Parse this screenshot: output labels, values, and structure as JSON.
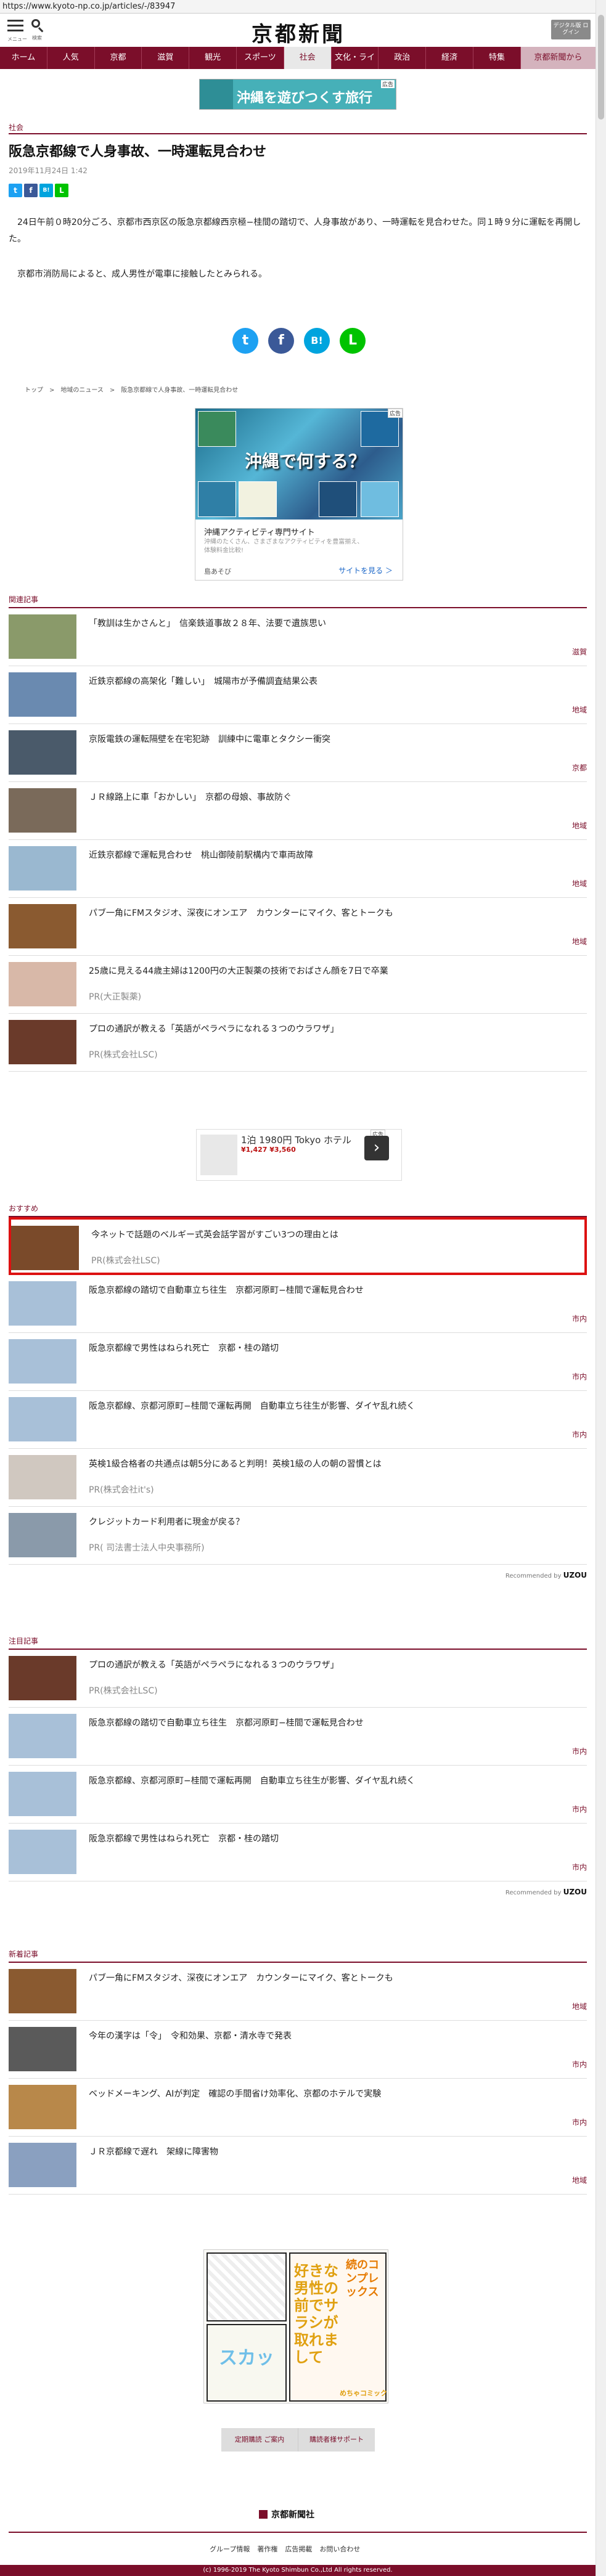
{
  "browser": {
    "url": "https://www.kyoto-np.co.jp/articles/-/83947"
  },
  "header": {
    "menu_label": "メニュー",
    "search_label": "検索",
    "logo": "京都新聞",
    "digital_button": "デジタル版 ログイン"
  },
  "nav": [
    "ホーム",
    "人気",
    "京都",
    "滋賀",
    "観光",
    "スポーツ",
    "社会",
    "文化・ライフ",
    "政治",
    "経済",
    "特集",
    "京都新聞から"
  ],
  "nav_active": "社会",
  "top_ad": {
    "text": "沖縄を遊びつくす旅行",
    "tag": "広告"
  },
  "article": {
    "category": "社会",
    "title": "阪急京都線で人身事故、一時運転見合わせ",
    "date": "2019年11月24日 1:42",
    "body": [
      "24日午前０時20分ごろ、京都市西京区の阪急京都線西京極−桂間の踏切で、人身事故があり、一時運転を見合わせた。同１時９分に運転を再開した。",
      "京都市消防局によると、成人男性が電車に接触したとみられる。"
    ]
  },
  "share": {
    "twitter": "t",
    "facebook": "f",
    "hatena": "B!",
    "line": "L"
  },
  "breadcrumb": [
    "トップ",
    ">",
    "地域のニュース",
    ">",
    "阪急京都線で人身事故、一時運転見合わせ"
  ],
  "okinawa_ad": {
    "heading": "沖縄で何する？",
    "headline": "沖縄アクティビティ専門サイト",
    "desc": "沖縄のたくさん、さまざまなアクティビティを豊富揃え、体験料金比較!",
    "advertiser": "島あそび",
    "cta": "サイトを見る ＞",
    "tag": "広告"
  },
  "related": {
    "label": "関連記事",
    "items": [
      {
        "title": "「教訓は生かさんと」　信楽鉄道事故２８年、法要で遺族思い",
        "tag": "滋賀",
        "color": "#8a9a6a"
      },
      {
        "title": "近鉄京都線の高架化「難しい」　城陽市が予備調査結果公表",
        "tag": "地域",
        "color": "#6a8ab0"
      },
      {
        "title": "京阪電鉄の運転隔壁を在宅犯跡　訓練中に電車とタクシー衝突",
        "tag": "京都",
        "color": "#4a5a6a"
      },
      {
        "title": "ＪＲ線路上に車「おかしい」　京都の母娘、事故防ぐ",
        "tag": "地域",
        "color": "#7a6a5a"
      },
      {
        "title": "近鉄京都線で運転見合わせ　桃山御陵前駅構内で車両故障",
        "tag": "地域",
        "color": "#9ab8d0"
      },
      {
        "title": "パブ一角にFMスタジオ、深夜にオンエア　カウンターにマイク、客とトークも",
        "tag": "地域",
        "color": "#8a5a30"
      },
      {
        "title": "25歳に見える44歳主婦は1200円の大正製薬の技術でおばさん顔を7日で卒業",
        "pr": "PR(大正製薬)",
        "color": "#d8b8a8"
      },
      {
        "title": "プロの通訳が教える「英語がペラペラになれる３つのウラワザ」",
        "pr": "PR(株式会社LSC)",
        "color": "#6a3a2a"
      }
    ]
  },
  "hotel_ad": {
    "title": "1泊 1980円 Tokyo ホテル",
    "price": "¥1,427 ¥3,560",
    "tag": "広告"
  },
  "recommend": {
    "label": "おすすめ",
    "items": [
      {
        "title": "今ネットで話題のベルギー式英会話学習がすごい3つの理由とは",
        "pr": "PR(株式会社LSC)",
        "color": "#7a4a2a",
        "highlight": true
      },
      {
        "title": "阪急京都線の踏切で自動車立ち往生　京都河原町−桂間で運転見合わせ",
        "tag": "市内",
        "color": "#a8c0d8"
      },
      {
        "title": "阪急京都線で男性はねられ死亡　京都・桂の踏切",
        "tag": "市内",
        "color": "#a8c0d8"
      },
      {
        "title": "阪急京都線、京都河原町−桂間で運転再開　自動車立ち往生が影響、ダイヤ乱れ続く",
        "tag": "市内",
        "color": "#a8c0d8"
      },
      {
        "title": "英検1級合格者の共通点は朝5分にあると判明！英検1級の人の朝の習慣とは",
        "pr": "PR(株式会社it's)",
        "color": "#d0c8c0"
      },
      {
        "title": "クレジットカード利用者に現金が戻る？",
        "pr": "PR( 司法書士法人中央事務所)",
        "color": "#8a9aaa"
      }
    ],
    "powered": "Recommended by",
    "brand": "UZOU"
  },
  "attention": {
    "label": "注目記事",
    "items": [
      {
        "title": "プロの通訳が教える「英語がペラペラになれる３つのウラワザ」",
        "pr": "PR(株式会社LSC)",
        "color": "#6a3a2a"
      },
      {
        "title": "阪急京都線の踏切で自動車立ち往生　京都河原町−桂間で運転見合わせ",
        "tag": "市内",
        "color": "#a8c0d8"
      },
      {
        "title": "阪急京都線、京都河原町−桂間で運転再開　自動車立ち往生が影響、ダイヤ乱れ続く",
        "tag": "市内",
        "color": "#a8c0d8"
      },
      {
        "title": "阪急京都線で男性はねられ死亡　京都・桂の踏切",
        "tag": "市内",
        "color": "#a8c0d8"
      }
    ],
    "powered": "Recommended by",
    "brand": "UZOU"
  },
  "latest": {
    "label": "新着記事",
    "items": [
      {
        "title": "パブ一角にFMスタジオ、深夜にオンエア　カウンターにマイク、客とトークも",
        "tag": "地域",
        "color": "#8a5a30"
      },
      {
        "title": "今年の漢字は「令」　令和効果、京都・清水寺で発表",
        "tag": "市内",
        "color": "#5a5a5a"
      },
      {
        "title": "ベッドメーキング、AIが判定　確認の手間省け効率化、京都のホテルで実験",
        "tag": "市内",
        "color": "#b8884a"
      },
      {
        "title": "ＪＲ京都線で遅れ　架線に障害物",
        "tag": "地域",
        "color": "#8aa0c0"
      }
    ]
  },
  "manga_ad": {
    "big": "好きな男性の前でサラシが取れまして",
    "sub": "続のコンプレックス",
    "title": "スカッ",
    "brand": "めちゃコミック"
  },
  "footer": {
    "links": [
      "定期購読 ご案内",
      "購読者様サポート"
    ],
    "logo": "京都新聞社",
    "nav": [
      "グループ情報",
      "著作権",
      "広告掲載",
      "お問い合わせ"
    ],
    "copyright": "(c) 1996-2019 The Kyoto Shimbun Co.,Ltd All rights reserved."
  }
}
